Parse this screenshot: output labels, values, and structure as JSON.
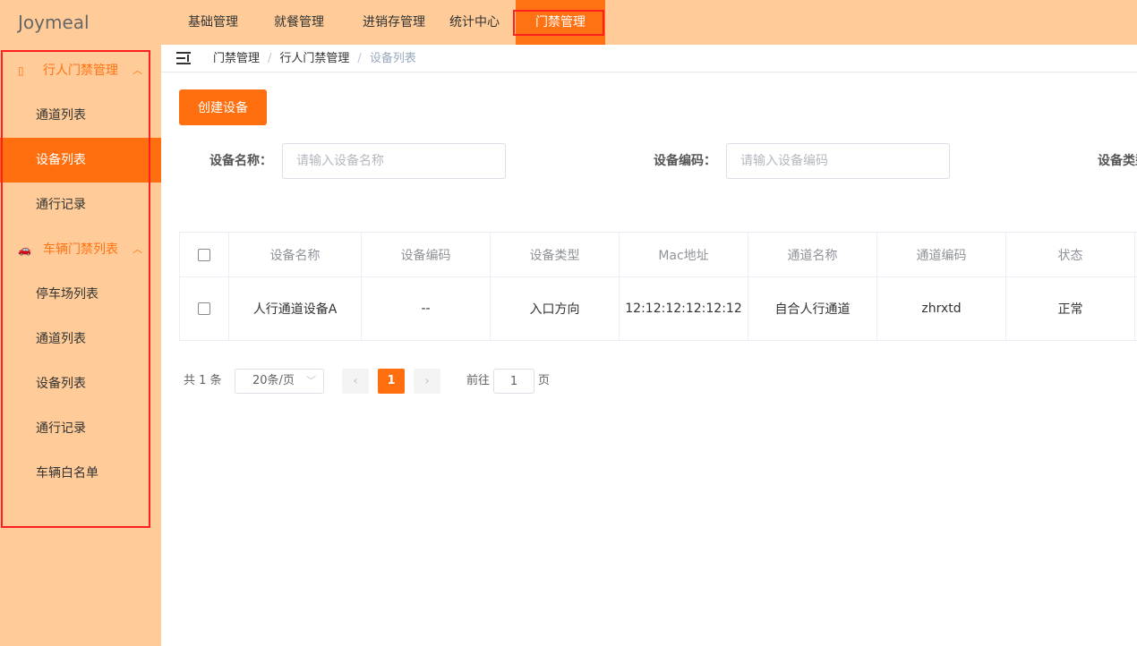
{
  "app": {
    "logo": "Joymeal"
  },
  "topnav": {
    "tabs": [
      {
        "label": "基础管理"
      },
      {
        "label": "就餐管理"
      },
      {
        "label": "进销存管理"
      },
      {
        "label": "统计中心"
      },
      {
        "label": "门禁管理",
        "active": true
      }
    ]
  },
  "sidebar": {
    "groups": [
      {
        "label": "行人门禁管理",
        "icon": "door-icon",
        "items": [
          {
            "label": "通道列表"
          },
          {
            "label": "设备列表",
            "active": true
          },
          {
            "label": "通行记录"
          }
        ]
      },
      {
        "label": "车辆门禁列表",
        "icon": "car-icon",
        "items": [
          {
            "label": "停车场列表"
          },
          {
            "label": "通道列表"
          },
          {
            "label": "设备列表"
          },
          {
            "label": "通行记录"
          },
          {
            "label": "车辆白名单"
          }
        ]
      }
    ]
  },
  "breadcrumb": [
    "门禁管理",
    "行人门禁管理",
    "设备列表"
  ],
  "toolbar": {
    "create_label": "创建设备"
  },
  "filters": {
    "name_label": "设备名称：",
    "name_placeholder": "请输入设备名称",
    "code_label": "设备编码：",
    "code_placeholder": "请输入设备编码",
    "type_label": "设备类型："
  },
  "table": {
    "columns": [
      "设备名称",
      "设备编码",
      "设备类型",
      "Mac地址",
      "通道名称",
      "通道编码",
      "状态"
    ],
    "rows": [
      [
        "人行通道设备A",
        "--",
        "入口方向",
        "12:12:12:12:12:12",
        "自合人行通道",
        "zhrxtd",
        "正常"
      ]
    ]
  },
  "pagination": {
    "total": "共 1 条",
    "page_size": "20条/页",
    "prev_icon": "‹",
    "next_icon": "›",
    "current_page": "1",
    "goto_label": "前往",
    "goto_value": "1",
    "page_suffix": "页"
  }
}
